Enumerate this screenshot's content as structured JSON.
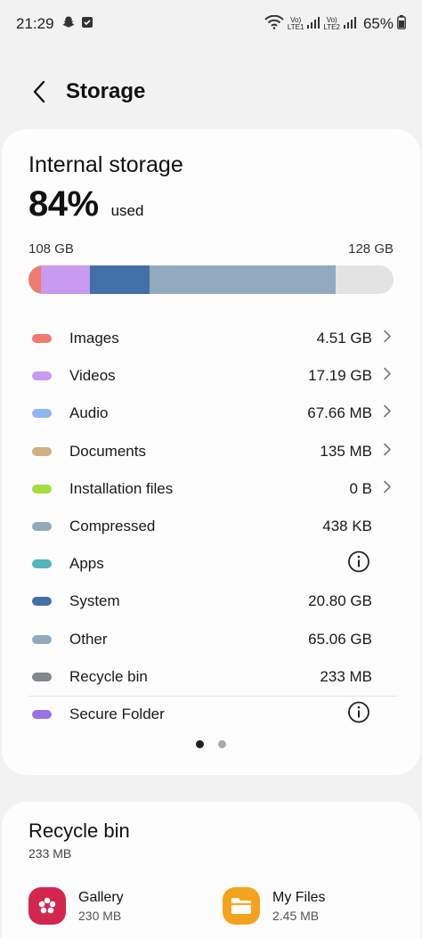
{
  "status_bar": {
    "time": "21:29",
    "lte1": "Vo)\nLTE1",
    "lte2": "Vo)\nLTE2",
    "battery": "65%",
    "icons": [
      "snapchat-icon",
      "notification-check-icon",
      "wifi-icon",
      "signal-icon",
      "battery-icon"
    ]
  },
  "header": {
    "title": "Storage"
  },
  "internal": {
    "title": "Internal storage",
    "percent": "84%",
    "used_label": "used",
    "used_amount": "108 GB",
    "total_amount": "128 GB",
    "bar_segments": [
      {
        "name": "Images",
        "fraction": 0.035,
        "color": "#ef7b6e"
      },
      {
        "name": "Videos",
        "fraction": 0.134,
        "color": "#c99af0"
      },
      {
        "name": "Audio",
        "fraction": 0.0005,
        "color": "#8eb6f0"
      },
      {
        "name": "System",
        "fraction": 0.163,
        "color": "#426fa8"
      },
      {
        "name": "Other",
        "fraction": 0.508,
        "color": "#91aabd"
      }
    ],
    "items": [
      {
        "label": "Images",
        "size": "4.51 GB",
        "color": "#ef7b6e",
        "action": "chevron"
      },
      {
        "label": "Videos",
        "size": "17.19 GB",
        "color": "#c99af0",
        "action": "chevron"
      },
      {
        "label": "Audio",
        "size": "67.66 MB",
        "color": "#8eb6f0",
        "action": "chevron"
      },
      {
        "label": "Documents",
        "size": "135 MB",
        "color": "#cfb083",
        "action": "chevron"
      },
      {
        "label": "Installation files",
        "size": "0 B",
        "color": "#a2de3e",
        "action": "chevron"
      },
      {
        "label": "Compressed",
        "size": "438 KB",
        "color": "#93a9bf",
        "action": "none"
      },
      {
        "label": "Apps",
        "size": "",
        "color": "#54b4b6",
        "action": "info"
      },
      {
        "label": "System",
        "size": "20.80 GB",
        "color": "#426fa8",
        "action": "none"
      },
      {
        "label": "Other",
        "size": "65.06 GB",
        "color": "#91aabd",
        "action": "none"
      },
      {
        "label": "Recycle bin",
        "size": "233 MB",
        "color": "#838790",
        "action": "none"
      },
      {
        "label": "Secure Folder",
        "size": "",
        "color": "#9a72e6",
        "action": "info"
      }
    ]
  },
  "recycle": {
    "title": "Recycle bin",
    "size": "233 MB",
    "apps": [
      {
        "name": "Gallery",
        "size": "230 MB",
        "icon": "gallery-icon",
        "color": "#d3264f"
      },
      {
        "name": "My Files",
        "size": "2.45 MB",
        "icon": "my-files-icon",
        "color": "#f5a31e"
      }
    ]
  }
}
